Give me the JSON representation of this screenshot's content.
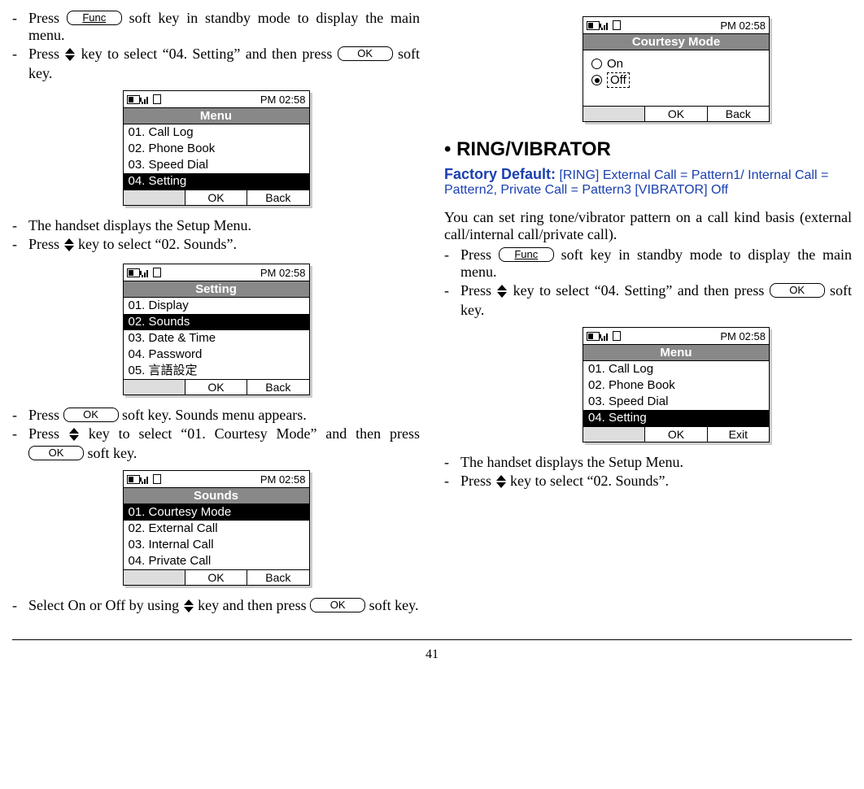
{
  "common": {
    "time": "PM 02:58",
    "ok": "OK",
    "back": "Back",
    "exit": "Exit",
    "func": "Func"
  },
  "left": {
    "step1a": "Press ",
    "step1b": " soft key in standby mode to display the main menu.",
    "step2a": "Press ",
    "step2b": " key to select “04. Setting” and then press ",
    "step2c": " soft key.",
    "menu1": {
      "title": "Menu",
      "items": [
        "01. Call Log",
        "02. Phone Book",
        "03. Speed Dial",
        "04. Setting"
      ],
      "selected": 3
    },
    "step3": "The handset displays the Setup Menu.",
    "step4a": "Press ",
    "step4b": " key to select “02. Sounds”.",
    "menu2": {
      "title": "Setting",
      "items": [
        "01. Display",
        "02. Sounds",
        "03. Date & Time",
        "04. Password",
        "05. 言語設定"
      ],
      "selected": 1
    },
    "step5a": "Press ",
    "step5b": " soft key. Sounds menu appears.",
    "step6a": "Press ",
    "step6b": " key to select “01. Courtesy Mode” and then press ",
    "step6c": " soft key.",
    "menu3": {
      "title": "Sounds",
      "items": [
        "01. Courtesy Mode",
        "02. External Call",
        "03. Internal Call",
        "04. Private Call"
      ],
      "selected": 0
    },
    "step7a": "Select On or Off by using ",
    "step7b": " key and then press ",
    "step7c": " soft key."
  },
  "right": {
    "courtesy": {
      "title": "Courtesy Mode",
      "on": "On",
      "off": "Off"
    },
    "section_title": "•  RING/VIBRATOR",
    "factory_label": "Factory Default:",
    "factory_text": " [RING] External Call = Pattern1/ Internal Call = Pattern2, Private Call = Pattern3 [VIBRATOR] Off",
    "intro": "You can set ring tone/vibrator pattern on a call kind basis (external call/internal call/private call).",
    "step1a": "Press ",
    "step1b": " soft key in standby mode to display the main menu.",
    "step2a": "Press ",
    "step2b": " key to select “04. Setting” and then press ",
    "step2c": " soft key.",
    "menu1": {
      "title": "Menu",
      "items": [
        "01. Call Log",
        "02. Phone Book",
        "03. Speed Dial",
        "04. Setting"
      ],
      "selected": 3
    },
    "step3": "The handset displays the Setup Menu.",
    "step4a": "Press ",
    "step4b": " key to select “02. Sounds”."
  },
  "pagenum": "41"
}
